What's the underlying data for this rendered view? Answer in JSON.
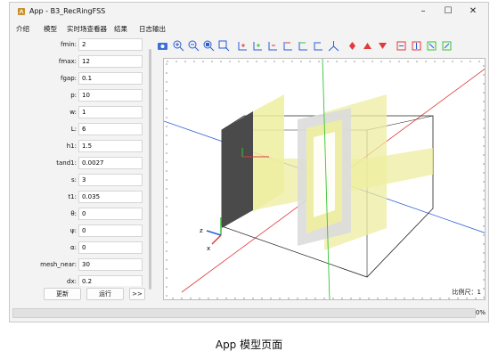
{
  "window": {
    "title": "App - B3_RecRingFSS"
  },
  "menu": [
    "介绍",
    "模型",
    "实时场查看器",
    "结果",
    "日志输出"
  ],
  "params": [
    {
      "label": "fmin:",
      "value": "2"
    },
    {
      "label": "fmax:",
      "value": "12"
    },
    {
      "label": "fgap:",
      "value": "0.1"
    },
    {
      "label": "p:",
      "value": "10"
    },
    {
      "label": "w:",
      "value": "1"
    },
    {
      "label": "L:",
      "value": "6"
    },
    {
      "label": "h1:",
      "value": "1.5"
    },
    {
      "label": "tand1:",
      "value": "0.0027"
    },
    {
      "label": "s:",
      "value": "3"
    },
    {
      "label": "t1:",
      "value": "0.035"
    },
    {
      "label": "θ:",
      "value": "0"
    },
    {
      "label": "ψ:",
      "value": "0"
    },
    {
      "label": "α:",
      "value": "0"
    },
    {
      "label": "mesh_near:",
      "value": "30"
    },
    {
      "label": "dx:",
      "value": "0.2"
    }
  ],
  "buttons": {
    "update": "更新",
    "run": "运行",
    "more": ">>"
  },
  "viewer": {
    "scale_text": "比例尺：1",
    "axis_z": "z",
    "axis_x": "x"
  },
  "progress": {
    "text": "0%",
    "value": 0
  },
  "caption": "App 模型页面",
  "colors": {
    "accent_red": "#e03a3a",
    "accent_blue": "#2a5bd7",
    "accent_green": "#35c435",
    "panel_yellow": "#eeeea0"
  }
}
